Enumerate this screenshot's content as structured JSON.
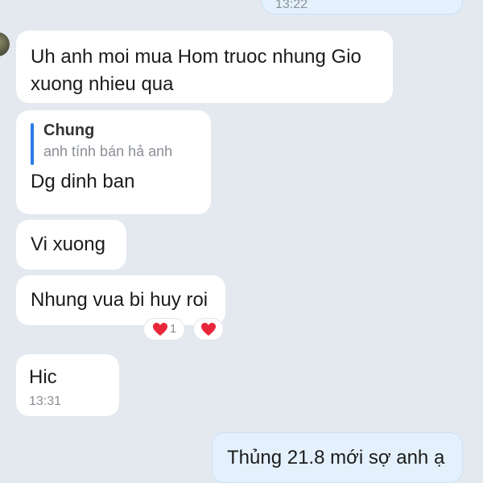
{
  "messages": {
    "top_sent": {
      "time": "13:22"
    },
    "m1": {
      "text": "Uh anh moi mua Hom truoc nhung Gio\nxuong nhieu qua"
    },
    "m2": {
      "quote_author": "Chung",
      "quote_text": "anh tính bán hả anh",
      "text": "Dg dinh ban"
    },
    "m3": {
      "text": "Vi xuong"
    },
    "m4": {
      "text": "Nhung vua bi huy roi",
      "reaction_count": "1",
      "reaction_icon": "heart-icon"
    },
    "m5": {
      "text": "Hic",
      "time": "13:31"
    },
    "m6": {
      "text": "Thủng 21.8 mới sợ anh ạ"
    }
  },
  "colors": {
    "background": "#e4e9ef",
    "received_bubble": "#ffffff",
    "sent_bubble": "#e4f1fd",
    "quote_bar": "#2c7ce8",
    "heart": "#e8283a"
  }
}
